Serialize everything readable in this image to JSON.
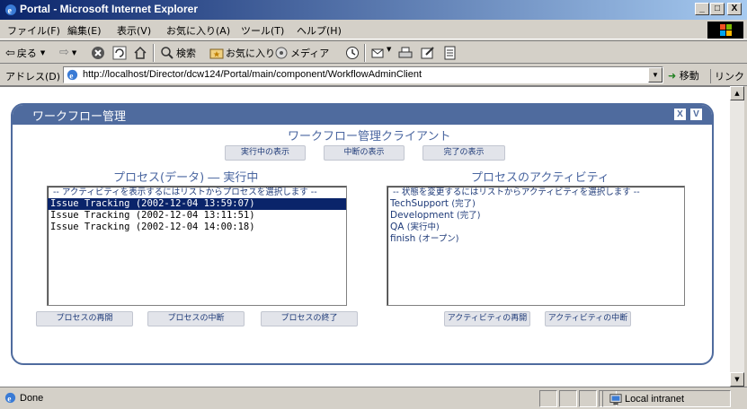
{
  "window": {
    "title": "Portal - Microsoft Internet Explorer",
    "controls": {
      "minimize": "_",
      "maximize": "□",
      "close": "X"
    }
  },
  "menu": [
    "ファイル(F)",
    "編集(E)",
    "表示(V)",
    "お気に入り(A)",
    "ツール(T)",
    "ヘルプ(H)"
  ],
  "toolbar": {
    "back": "戻る",
    "search": "検索",
    "favorites": "お気に入り",
    "media": "メディア"
  },
  "address": {
    "label": "アドレス(D)",
    "url": "http://localhost/Director/dcw124/Portal/main/component/WorkflowAdminClient",
    "go": "移動",
    "links": "リンク"
  },
  "portlet": {
    "title": "ワークフロー管理",
    "edit_btn": "X",
    "view_btn": "V",
    "client_title": "ワークフロー管理クライアント",
    "filter_buttons": [
      "実行中の表示",
      "中断の表示",
      "完了の表示"
    ],
    "process_heading": "プロセス(データ) ― 実行中",
    "activity_heading": "プロセスのアクティビティ",
    "process_hint": "-- アクティビティを表示するにはリストからプロセスを選択します --",
    "processes": [
      "Issue Tracking (2002-12-04 13:59:07)",
      "Issue Tracking (2002-12-04 13:11:51)",
      "Issue Tracking (2002-12-04 14:00:18)"
    ],
    "selected_process_index": 0,
    "activity_hint": "-- 状態を変更するにはリストからアクティビティを選択します --",
    "activities": [
      {
        "name": "TechSupport",
        "status": "(完了)"
      },
      {
        "name": "Development",
        "status": "(完了)"
      },
      {
        "name": "QA",
        "status": "(実行中)"
      },
      {
        "name": "finish",
        "status": "(オープン)"
      }
    ],
    "process_actions": [
      "プロセスの再開",
      "プロセスの中断",
      "プロセスの終了"
    ],
    "activity_actions": [
      "アクティビティの再開",
      "アクティビティの中断"
    ]
  },
  "status": {
    "text": "Done",
    "zone": "Local intranet"
  },
  "colors": {
    "portlet_accent": "#4f6b9e",
    "heading_text": "#4a66a0",
    "selection": "#0a246a"
  }
}
